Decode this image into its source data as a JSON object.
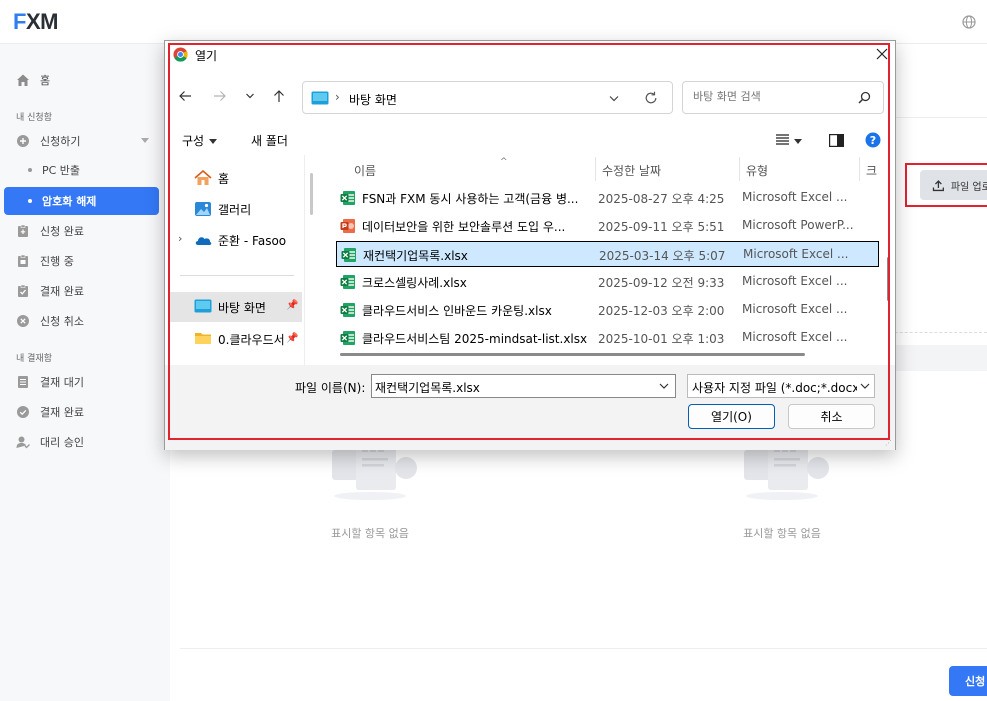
{
  "app": {
    "logo_f": "F",
    "logo_rest": "XM"
  },
  "sidebar": {
    "home": "홈",
    "section_my_requests": "내 신청함",
    "request": "신청하기",
    "pc_export": "PC 반출",
    "decrypt": "암호화 해제",
    "request_done": "신청 완료",
    "in_progress": "진행 중",
    "approval_done": "결재 완료",
    "request_cancel": "신청 취소",
    "section_my_approvals": "내 결재함",
    "approval_wait": "결재 대기",
    "approval_complete": "결재 완료",
    "proxy_approval": "대리 승인"
  },
  "main": {
    "upload_button": "파일 업로드",
    "empty_left": "표시할 항목 없음",
    "empty_right": "표시할 항목 없음",
    "submit_button": "신청"
  },
  "dialog": {
    "title": "열기",
    "address_path": "바탕 화면",
    "search_placeholder": "바탕 화면 검색",
    "organize": "구성",
    "new_folder": "새 폴더",
    "nav": {
      "home": "홈",
      "gallery": "갤러리",
      "onedrive": "준환 - Fasoo",
      "desktop": "바탕 화면",
      "cloud_folder": "0.클라우드서"
    },
    "columns": {
      "name": "이름",
      "modified": "수정한 날짜",
      "type": "유형",
      "size": "크"
    },
    "files": [
      {
        "name": "FSN과 FXM 동시 사용하는 고객(금융 병...",
        "date": "2025-08-27 오후 4:25",
        "type": "Microsoft Excel ...",
        "kind": "excel"
      },
      {
        "name": "데이터보안을 위한 보안솔루션 도입 우...",
        "date": "2025-09-11 오후 5:51",
        "type": "Microsoft PowerP...",
        "kind": "ppt"
      },
      {
        "name": "재컨택기업목록.xlsx",
        "date": "2025-03-14 오후 5:07",
        "type": "Microsoft Excel ...",
        "kind": "excel"
      },
      {
        "name": "크로스셀링사례.xlsx",
        "date": "2025-09-12 오전 9:33",
        "type": "Microsoft Excel ...",
        "kind": "excel"
      },
      {
        "name": "클라우드서비스 인바운드 카운팅.xlsx",
        "date": "2025-12-03 오후 2:00",
        "type": "Microsoft Excel ...",
        "kind": "excel"
      },
      {
        "name": "클라우드서비스팀 2025-mindsat-list.xlsx",
        "date": "2025-10-01 오후 1:03",
        "type": "Microsoft Excel ...",
        "kind": "excel"
      }
    ],
    "selected_index": 2,
    "file_name_label": "파일 이름(N):",
    "file_name_value": "재컨택기업목록.xlsx",
    "file_type": "사용자 지정 파일 (*.doc;*.docx",
    "open_button": "열기(O)",
    "cancel_button": "취소"
  },
  "colors": {
    "accent": "#3478f6",
    "highlight_red": "#e0232e",
    "selection": "#cde8ff"
  }
}
